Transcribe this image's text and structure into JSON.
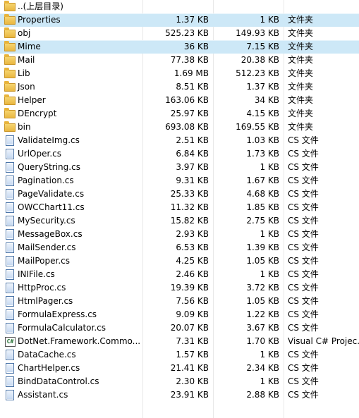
{
  "parent": {
    "label": "..(上层目录)"
  },
  "rows": [
    {
      "kind": "folder",
      "name": "Properties",
      "size": "1.37 KB",
      "packed": "1 KB",
      "type": "文件夹",
      "selected": true
    },
    {
      "kind": "folder",
      "name": "obj",
      "size": "525.23 KB",
      "packed": "149.93 KB",
      "type": "文件夹"
    },
    {
      "kind": "folder",
      "name": "Mime",
      "size": "36 KB",
      "packed": "7.15 KB",
      "type": "文件夹",
      "selected": true
    },
    {
      "kind": "folder",
      "name": "Mail",
      "size": "77.38 KB",
      "packed": "20.38 KB",
      "type": "文件夹"
    },
    {
      "kind": "folder",
      "name": "Lib",
      "size": "1.69 MB",
      "packed": "512.23 KB",
      "type": "文件夹"
    },
    {
      "kind": "folder",
      "name": "Json",
      "size": "8.51 KB",
      "packed": "1.37 KB",
      "type": "文件夹"
    },
    {
      "kind": "folder",
      "name": "Helper",
      "size": "163.06 KB",
      "packed": "34 KB",
      "type": "文件夹"
    },
    {
      "kind": "folder",
      "name": "DEncrypt",
      "size": "25.97 KB",
      "packed": "4.15 KB",
      "type": "文件夹"
    },
    {
      "kind": "folder",
      "name": "bin",
      "size": "693.08 KB",
      "packed": "169.55 KB",
      "type": "文件夹"
    },
    {
      "kind": "file",
      "name": "ValidateImg.cs",
      "size": "2.51 KB",
      "packed": "1.03 KB",
      "type": "CS 文件"
    },
    {
      "kind": "file",
      "name": "UrlOper.cs",
      "size": "6.84 KB",
      "packed": "1.73 KB",
      "type": "CS 文件"
    },
    {
      "kind": "file",
      "name": "QueryString.cs",
      "size": "3.97 KB",
      "packed": "1 KB",
      "type": "CS 文件"
    },
    {
      "kind": "file",
      "name": "Pagination.cs",
      "size": "9.31 KB",
      "packed": "1.67 KB",
      "type": "CS 文件"
    },
    {
      "kind": "file",
      "name": "PageValidate.cs",
      "size": "25.33 KB",
      "packed": "4.68 KB",
      "type": "CS 文件"
    },
    {
      "kind": "file",
      "name": "OWCChart11.cs",
      "size": "11.32 KB",
      "packed": "1.85 KB",
      "type": "CS 文件"
    },
    {
      "kind": "file",
      "name": "MySecurity.cs",
      "size": "15.82 KB",
      "packed": "2.75 KB",
      "type": "CS 文件"
    },
    {
      "kind": "file",
      "name": "MessageBox.cs",
      "size": "2.93 KB",
      "packed": "1 KB",
      "type": "CS 文件"
    },
    {
      "kind": "file",
      "name": "MailSender.cs",
      "size": "6.53 KB",
      "packed": "1.39 KB",
      "type": "CS 文件"
    },
    {
      "kind": "file",
      "name": "MailPoper.cs",
      "size": "4.25 KB",
      "packed": "1.05 KB",
      "type": "CS 文件"
    },
    {
      "kind": "file",
      "name": "INIFile.cs",
      "size": "2.46 KB",
      "packed": "1 KB",
      "type": "CS 文件"
    },
    {
      "kind": "file",
      "name": "HttpProc.cs",
      "size": "19.39 KB",
      "packed": "3.72 KB",
      "type": "CS 文件"
    },
    {
      "kind": "file",
      "name": "HtmlPager.cs",
      "size": "7.56 KB",
      "packed": "1.05 KB",
      "type": "CS 文件"
    },
    {
      "kind": "file",
      "name": "FormulaExpress.cs",
      "size": "9.09 KB",
      "packed": "1.22 KB",
      "type": "CS 文件"
    },
    {
      "kind": "file",
      "name": "FormulaCalculator.cs",
      "size": "20.07 KB",
      "packed": "3.67 KB",
      "type": "CS 文件"
    },
    {
      "kind": "proj",
      "name": "DotNet.Framework.Commo...",
      "size": "7.31 KB",
      "packed": "1.70 KB",
      "type": "Visual C# Projec..."
    },
    {
      "kind": "file",
      "name": "DataCache.cs",
      "size": "1.57 KB",
      "packed": "1 KB",
      "type": "CS 文件"
    },
    {
      "kind": "file",
      "name": "ChartHelper.cs",
      "size": "21.41 KB",
      "packed": "2.34 KB",
      "type": "CS 文件"
    },
    {
      "kind": "file",
      "name": "BindDataControl.cs",
      "size": "2.30 KB",
      "packed": "1 KB",
      "type": "CS 文件"
    },
    {
      "kind": "file",
      "name": "Assistant.cs",
      "size": "23.91 KB",
      "packed": "2.88 KB",
      "type": "CS 文件"
    }
  ],
  "icons": {
    "folder": "folder-icon",
    "file": "cs-file-icon",
    "proj": "csproj-file-icon",
    "proj_glyph": "C#"
  },
  "colors": {
    "selection": "#cde8f7",
    "folder": "#e8b43c"
  }
}
